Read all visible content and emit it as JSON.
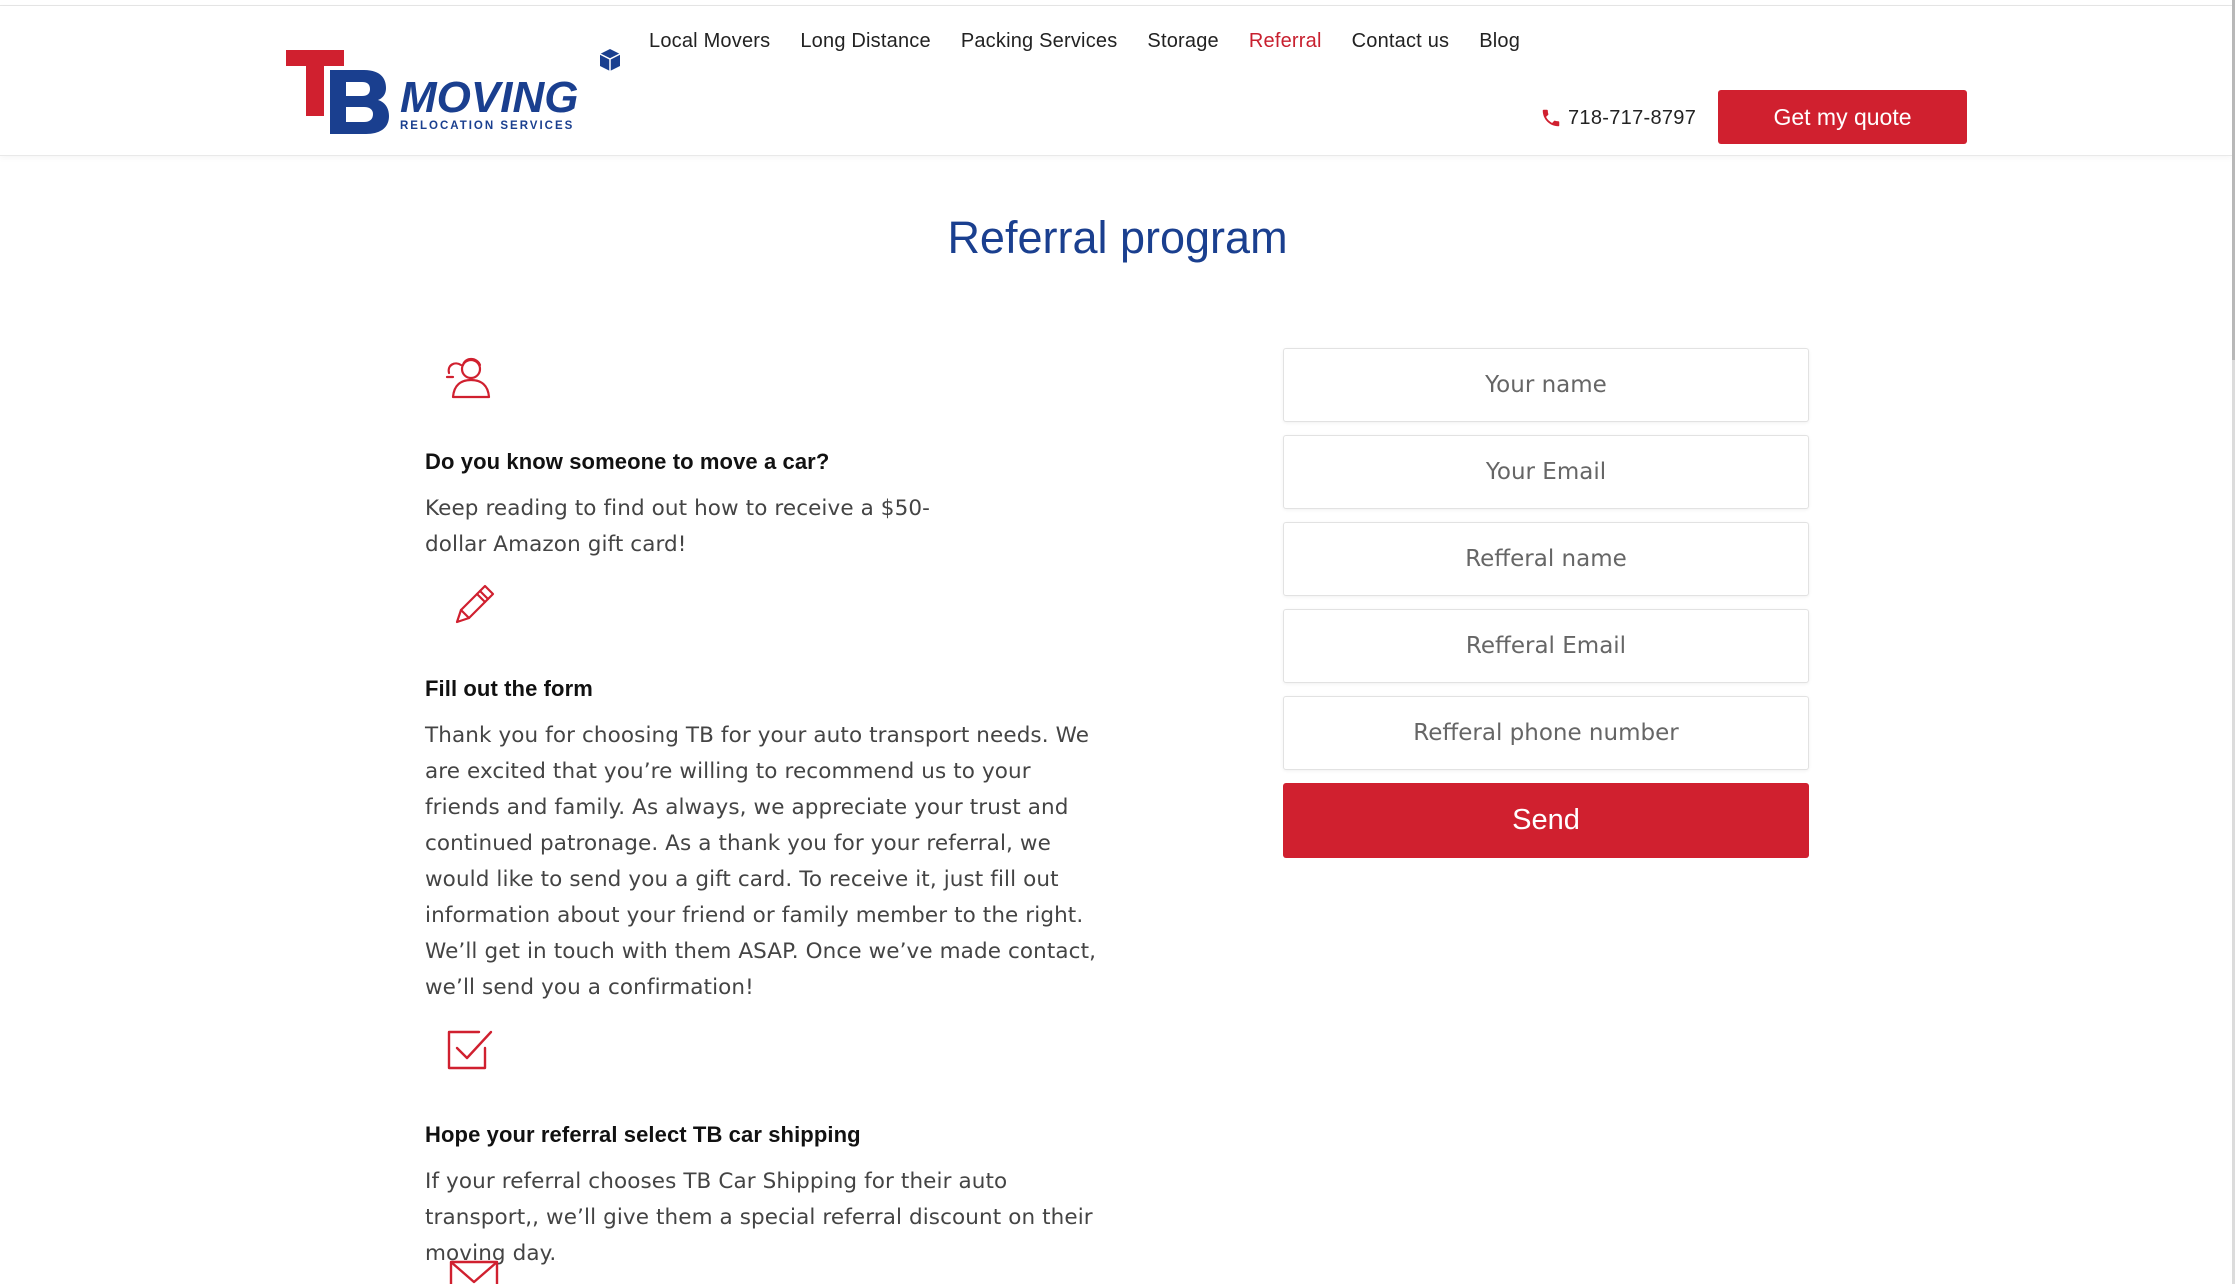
{
  "brand": {
    "logo_letters": "TB",
    "logo_word": "MOVING",
    "logo_tagline": "RELOCATION SERVICES",
    "primary_color": "#1a3f8f",
    "accent_color": "#d0202f"
  },
  "nav": {
    "items": [
      {
        "label": "Local Movers",
        "active": false
      },
      {
        "label": "Long Distance",
        "active": false
      },
      {
        "label": "Packing Services",
        "active": false
      },
      {
        "label": "Storage",
        "active": false
      },
      {
        "label": "Referral",
        "active": true
      },
      {
        "label": "Contact us",
        "active": false
      },
      {
        "label": "Blog",
        "active": false
      }
    ]
  },
  "header": {
    "phone": "718-717-8797",
    "phone_icon": "phone-icon",
    "quote_button": "Get my quote"
  },
  "page": {
    "title": "Referral program"
  },
  "steps": [
    {
      "icon": "person-icon",
      "heading": "Do you know someone to move a car?",
      "text": "Keep reading to find out how to receive a $50-dollar Amazon gift card!"
    },
    {
      "icon": "pencil-icon",
      "heading": "Fill out the form",
      "text": "Thank you for choosing TB for your auto transport needs. We are excited that you’re willing to recommend us to your friends and family. As always, we appreciate your trust and continued patronage. As a thank you for your referral, we would like to send you a gift card. To receive it, just fill out information about your friend or family member to the right. We’ll get in touch with them ASAP. Once we’ve made contact, we’ll send you a confirmation!"
    },
    {
      "icon": "checkbox-icon",
      "heading": "Hope your referral select TB car shipping",
      "text": "If your referral chooses TB Car Shipping for their auto transport,, we’ll give them a special referral discount on their moving day."
    },
    {
      "icon": "envelope-icon"
    }
  ],
  "form": {
    "your_name_placeholder": "Your name",
    "your_email_placeholder": "Your Email",
    "referral_name_placeholder": "Refferal name",
    "referral_email_placeholder": "Refferal Email",
    "referral_phone_placeholder": "Refferal phone number",
    "submit_label": "Send"
  }
}
